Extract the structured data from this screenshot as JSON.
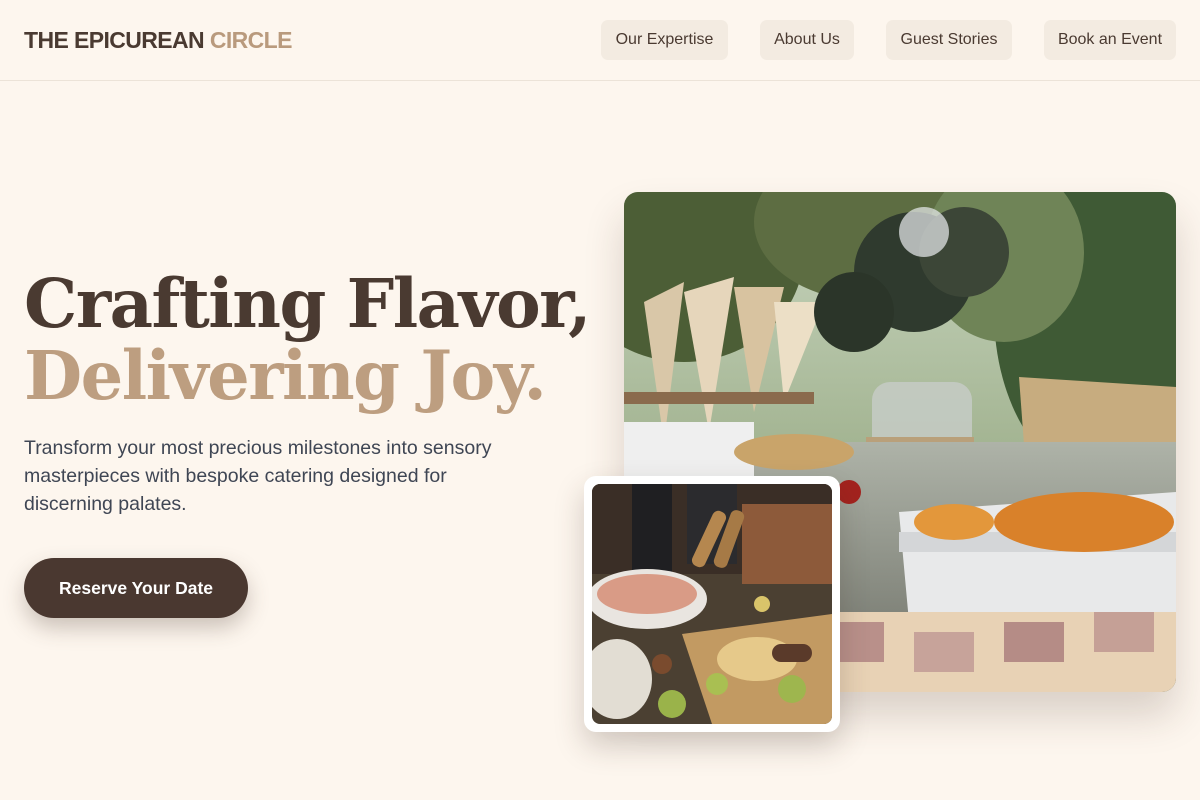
{
  "header": {
    "logo_main": "THE EPICUREAN",
    "logo_accent": "CIRCLE",
    "nav": [
      {
        "label": "Our Expertise"
      },
      {
        "label": "About Us"
      },
      {
        "label": "Guest Stories"
      },
      {
        "label": "Book an Event"
      }
    ]
  },
  "hero": {
    "title_line1": "Crafting Flavor,",
    "title_line2": "Delivering Joy.",
    "subtitle": "Transform your most precious milestones into sensory masterpieces with bespoke catering designed for discerning palates.",
    "cta_label": "Reserve Your Date"
  },
  "colors": {
    "background": "#fdf6ee",
    "brand_dark": "#4a3830",
    "brand_accent": "#bd9e80",
    "nav_button": "#f3ebe1"
  }
}
